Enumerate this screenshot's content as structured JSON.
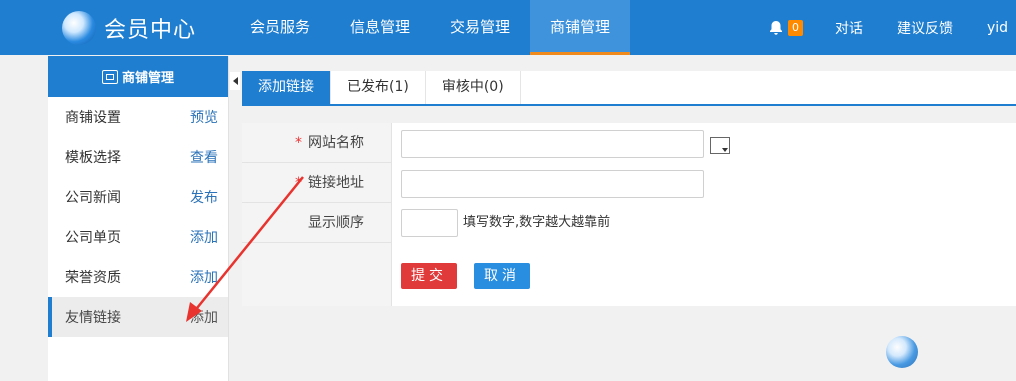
{
  "header": {
    "brand": "会员中心",
    "nav": [
      "会员服务",
      "信息管理",
      "交易管理",
      "商铺管理"
    ],
    "active_nav": "商铺管理",
    "notifications": "0",
    "links": [
      "对话",
      "建议反馈",
      "yid"
    ]
  },
  "sidebar": {
    "title": "商铺管理",
    "items": [
      {
        "label": "商铺设置",
        "action": "预览"
      },
      {
        "label": "模板选择",
        "action": "查看"
      },
      {
        "label": "公司新闻",
        "action": "发布"
      },
      {
        "label": "公司单页",
        "action": "添加"
      },
      {
        "label": "荣誉资质",
        "action": "添加"
      },
      {
        "label": "友情链接",
        "action": "添加"
      }
    ]
  },
  "tabs": [
    "添加链接",
    "已发布(1)",
    "审核中(0)"
  ],
  "form": {
    "site_name_label": "网站名称",
    "site_name_value": "",
    "url_label": "链接地址",
    "url_value": "",
    "order_label": "显示顺序",
    "order_value": "",
    "order_hint": "填写数字,数字越大越靠前",
    "submit": "提交",
    "cancel": "取消"
  },
  "colors": {
    "primary": "#1f7ed0",
    "badge": "#ff8a00",
    "submit": "#e03a3a",
    "cancel": "#2a8ee0",
    "arrow": "#e8332e"
  },
  "watermark_icon": "brand-globe-icon"
}
